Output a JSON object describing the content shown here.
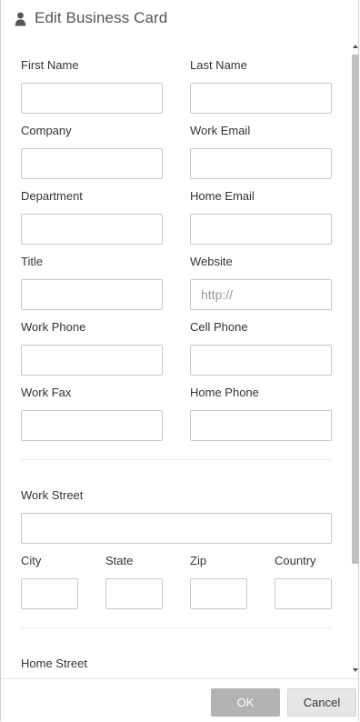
{
  "dialog": {
    "title": "Edit Business Card",
    "icon": "user-icon"
  },
  "form": {
    "first_name": {
      "label": "First Name",
      "value": "",
      "placeholder": ""
    },
    "last_name": {
      "label": "Last Name",
      "value": "",
      "placeholder": ""
    },
    "company": {
      "label": "Company",
      "value": "",
      "placeholder": ""
    },
    "work_email": {
      "label": "Work Email",
      "value": "",
      "placeholder": ""
    },
    "department": {
      "label": "Department",
      "value": "",
      "placeholder": ""
    },
    "home_email": {
      "label": "Home Email",
      "value": "",
      "placeholder": ""
    },
    "title": {
      "label": "Title",
      "value": "",
      "placeholder": ""
    },
    "website": {
      "label": "Website",
      "value": "",
      "placeholder": "http://"
    },
    "work_phone": {
      "label": "Work Phone",
      "value": "",
      "placeholder": ""
    },
    "cell_phone": {
      "label": "Cell Phone",
      "value": "",
      "placeholder": ""
    },
    "work_fax": {
      "label": "Work Fax",
      "value": "",
      "placeholder": ""
    },
    "home_phone": {
      "label": "Home Phone",
      "value": "",
      "placeholder": ""
    },
    "work_street": {
      "label": "Work Street",
      "value": "",
      "placeholder": ""
    },
    "city": {
      "label": "City",
      "value": "",
      "placeholder": ""
    },
    "state": {
      "label": "State",
      "value": "",
      "placeholder": ""
    },
    "zip": {
      "label": "Zip",
      "value": "",
      "placeholder": ""
    },
    "country": {
      "label": "Country",
      "value": "",
      "placeholder": ""
    },
    "home_street": {
      "label": "Home Street"
    }
  },
  "footer": {
    "ok_label": "OK",
    "cancel_label": "Cancel"
  },
  "colors": {
    "ok_button_bg": "#b3b3b3",
    "cancel_button_bg": "#e6e6e6",
    "field_border": "#c9c9c9"
  }
}
